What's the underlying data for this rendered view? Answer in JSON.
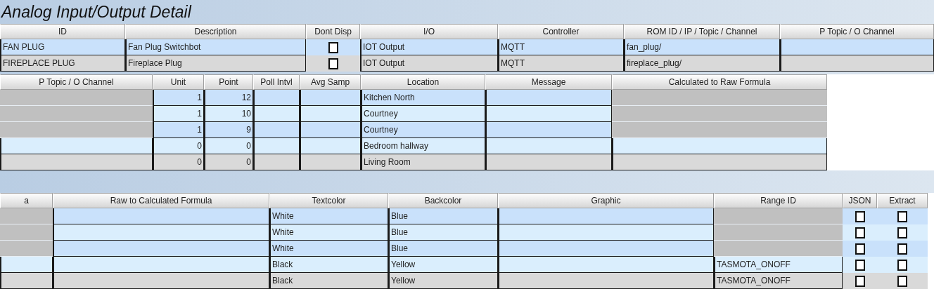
{
  "title": "Analog Input/Output Detail",
  "panels": [
    {
      "columns": [
        "ID",
        "Description",
        "Dont Disp",
        "I/O",
        "Controller",
        "ROM ID / IP / Topic / Channel",
        "P Topic / O Channel"
      ],
      "rows": [
        {
          "shaded": false,
          "cells": [
            {
              "kind": "text",
              "text": "FAN PLUG",
              "disabled": false
            },
            {
              "kind": "text",
              "text": "Fan Plug Switchbot",
              "disabled": false
            },
            {
              "kind": "checkbox",
              "checked": false
            },
            {
              "kind": "text",
              "text": "IOT Output",
              "disabled": false
            },
            {
              "kind": "text",
              "text": "MQTT",
              "disabled": false
            },
            {
              "kind": "text",
              "text": "fan_plug/",
              "disabled": false
            },
            {
              "kind": "text",
              "disabled": false
            }
          ]
        },
        {
          "shaded": true,
          "cells": [
            {
              "kind": "text",
              "text": "FIREPLACE PLUG",
              "disabled": false
            },
            {
              "kind": "text",
              "text": "Fireplace Plug",
              "disabled": false
            },
            {
              "kind": "checkbox",
              "checked": false
            },
            {
              "kind": "text",
              "text": "IOT Output",
              "disabled": false
            },
            {
              "kind": "text",
              "text": "MQTT",
              "disabled": false
            },
            {
              "kind": "text",
              "text": "fireplace_plug/",
              "disabled": false
            },
            {
              "kind": "text",
              "disabled": false
            }
          ]
        }
      ]
    },
    {
      "columns": [
        "P Topic / O Channel",
        "Unit",
        "Point",
        "Poll Intvl",
        "Avg Samp",
        "Location",
        "Message",
        "Calculated to Raw Formula"
      ],
      "rows": [
        {
          "shaded": false,
          "cells": [
            {
              "kind": "text",
              "disabled": true
            },
            {
              "kind": "text",
              "text": "1",
              "disabled": false
            },
            {
              "kind": "text",
              "text": "12",
              "disabled": false
            },
            {
              "kind": "text",
              "disabled": false
            },
            {
              "kind": "text",
              "disabled": false
            },
            {
              "kind": "text",
              "text": "Kitchen North",
              "disabled": false
            },
            {
              "kind": "text",
              "disabled": false
            },
            {
              "kind": "text",
              "disabled": true
            }
          ]
        },
        {
          "shaded": false,
          "cells": [
            {
              "kind": "text",
              "disabled": true
            },
            {
              "kind": "text",
              "text": "1",
              "disabled": false
            },
            {
              "kind": "text",
              "text": "10",
              "disabled": false
            },
            {
              "kind": "text",
              "disabled": false
            },
            {
              "kind": "text",
              "disabled": false
            },
            {
              "kind": "text",
              "text": "Courtney",
              "disabled": false
            },
            {
              "kind": "text",
              "disabled": false
            },
            {
              "kind": "text",
              "disabled": true
            }
          ]
        },
        {
          "shaded": false,
          "cells": [
            {
              "kind": "text",
              "disabled": true
            },
            {
              "kind": "text",
              "text": "1",
              "disabled": false
            },
            {
              "kind": "text",
              "text": "9",
              "disabled": false
            },
            {
              "kind": "text",
              "disabled": false
            },
            {
              "kind": "text",
              "disabled": false
            },
            {
              "kind": "text",
              "text": "Courtney",
              "disabled": false
            },
            {
              "kind": "text",
              "disabled": false
            },
            {
              "kind": "text",
              "disabled": true
            }
          ]
        },
        {
          "shaded": false,
          "cells": [
            {
              "kind": "text",
              "disabled": false
            },
            {
              "kind": "text",
              "text": "0",
              "disabled": false
            },
            {
              "kind": "text",
              "text": "0",
              "disabled": false
            },
            {
              "kind": "text",
              "disabled": false
            },
            {
              "kind": "text",
              "disabled": false
            },
            {
              "kind": "text",
              "text": "Bedroom hallway",
              "disabled": false
            },
            {
              "kind": "text",
              "disabled": false
            },
            {
              "kind": "text",
              "disabled": false
            }
          ]
        },
        {
          "shaded": true,
          "cells": [
            {
              "kind": "text",
              "disabled": false
            },
            {
              "kind": "text",
              "text": "0",
              "disabled": false
            },
            {
              "kind": "text",
              "text": "0",
              "disabled": false
            },
            {
              "kind": "text",
              "disabled": false
            },
            {
              "kind": "text",
              "disabled": false
            },
            {
              "kind": "text",
              "text": "Living Room",
              "disabled": false
            },
            {
              "kind": "text",
              "disabled": false
            },
            {
              "kind": "text",
              "disabled": false
            }
          ]
        }
      ]
    },
    {
      "columns": [
        "a",
        "Raw to Calculated Formula",
        "Textcolor",
        "Backcolor",
        "Graphic",
        "Range ID",
        "JSON",
        "Extract"
      ],
      "rows": [
        {
          "shaded": false,
          "cells": [
            {
              "kind": "text",
              "disabled": true
            },
            {
              "kind": "text",
              "disabled": false
            },
            {
              "kind": "text",
              "text": "White",
              "disabled": false
            },
            {
              "kind": "text",
              "text": "Blue",
              "disabled": false
            },
            {
              "kind": "text",
              "disabled": false
            },
            {
              "kind": "text",
              "disabled": true
            },
            {
              "kind": "checkbox",
              "checked": false
            },
            {
              "kind": "checkbox",
              "checked": false
            }
          ]
        },
        {
          "shaded": false,
          "cells": [
            {
              "kind": "text",
              "disabled": true
            },
            {
              "kind": "text",
              "disabled": false
            },
            {
              "kind": "text",
              "text": "White",
              "disabled": false
            },
            {
              "kind": "text",
              "text": "Blue",
              "disabled": false
            },
            {
              "kind": "text",
              "disabled": false
            },
            {
              "kind": "text",
              "disabled": true
            },
            {
              "kind": "checkbox",
              "checked": false
            },
            {
              "kind": "checkbox",
              "checked": false
            }
          ]
        },
        {
          "shaded": false,
          "cells": [
            {
              "kind": "text",
              "disabled": true
            },
            {
              "kind": "text",
              "disabled": false
            },
            {
              "kind": "text",
              "text": "White",
              "disabled": false
            },
            {
              "kind": "text",
              "text": "Blue",
              "disabled": false
            },
            {
              "kind": "text",
              "disabled": false
            },
            {
              "kind": "text",
              "disabled": true
            },
            {
              "kind": "checkbox",
              "checked": false
            },
            {
              "kind": "checkbox",
              "checked": false
            }
          ]
        },
        {
          "shaded": false,
          "cells": [
            {
              "kind": "text",
              "disabled": false
            },
            {
              "kind": "text",
              "disabled": false
            },
            {
              "kind": "text",
              "text": "Black",
              "disabled": false
            },
            {
              "kind": "text",
              "text": "Yellow",
              "disabled": false
            },
            {
              "kind": "text",
              "disabled": false
            },
            {
              "kind": "text",
              "text": "TASMOTA_ONOFF",
              "disabled": false
            },
            {
              "kind": "checkbox",
              "checked": false
            },
            {
              "kind": "checkbox",
              "checked": false
            }
          ]
        },
        {
          "shaded": true,
          "cells": [
            {
              "kind": "text",
              "disabled": false
            },
            {
              "kind": "text",
              "disabled": false
            },
            {
              "kind": "text",
              "text": "Black",
              "disabled": false
            },
            {
              "kind": "text",
              "text": "Yellow",
              "disabled": false
            },
            {
              "kind": "text",
              "disabled": false
            },
            {
              "kind": "text",
              "text": "TASMOTA_ONOFF",
              "disabled": false
            },
            {
              "kind": "checkbox",
              "checked": false
            },
            {
              "kind": "checkbox",
              "checked": false
            }
          ]
        }
      ]
    }
  ]
}
